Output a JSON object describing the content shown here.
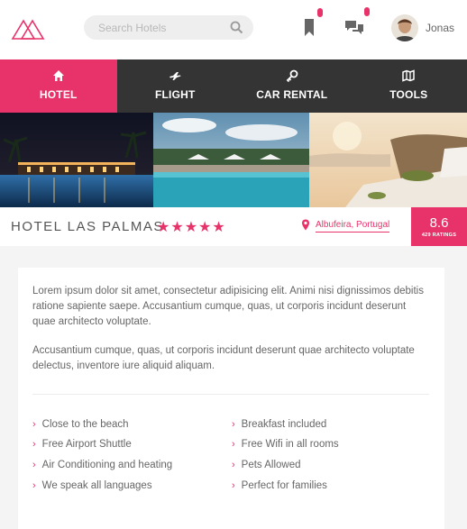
{
  "header": {
    "search_placeholder": "Search Hotels",
    "user_name": "Jonas",
    "brand_color": "#e8326a"
  },
  "nav": {
    "tabs": [
      {
        "label": "HOTEL",
        "icon": "home-icon",
        "active": true
      },
      {
        "label": "FLIGHT",
        "icon": "plane-icon",
        "active": false
      },
      {
        "label": "CAR RENTAL",
        "icon": "key-icon",
        "active": false
      },
      {
        "label": "TOOLS",
        "icon": "map-icon",
        "active": false
      }
    ]
  },
  "hotel": {
    "name": "HOTEL LAS PALMAS",
    "stars_display": "★★★★★",
    "star_count": 5,
    "location": "Albufeira, Portugal",
    "rating": "8.6",
    "ratings_count": "429 RATINGS"
  },
  "description": {
    "paragraph_1": "Lorem ipsum dolor sit amet, consectetur adipisicing elit. Animi nisi dignissimos debitis ratione sapiente saepe. Accusantium cumque, quas, ut corporis incidunt deserunt quae architecto voluptate.",
    "paragraph_2": "Accusantium cumque, quas, ut corporis incidunt deserunt quae architecto voluptate delectus, inventore iure aliquid aliquam."
  },
  "features": [
    "Close to the beach",
    "Breakfast included",
    "Free Airport Shuttle",
    "Free Wifi in all rooms",
    "Air Conditioning and heating",
    "Pets Allowed",
    "We speak all languages",
    "Perfect for families"
  ]
}
